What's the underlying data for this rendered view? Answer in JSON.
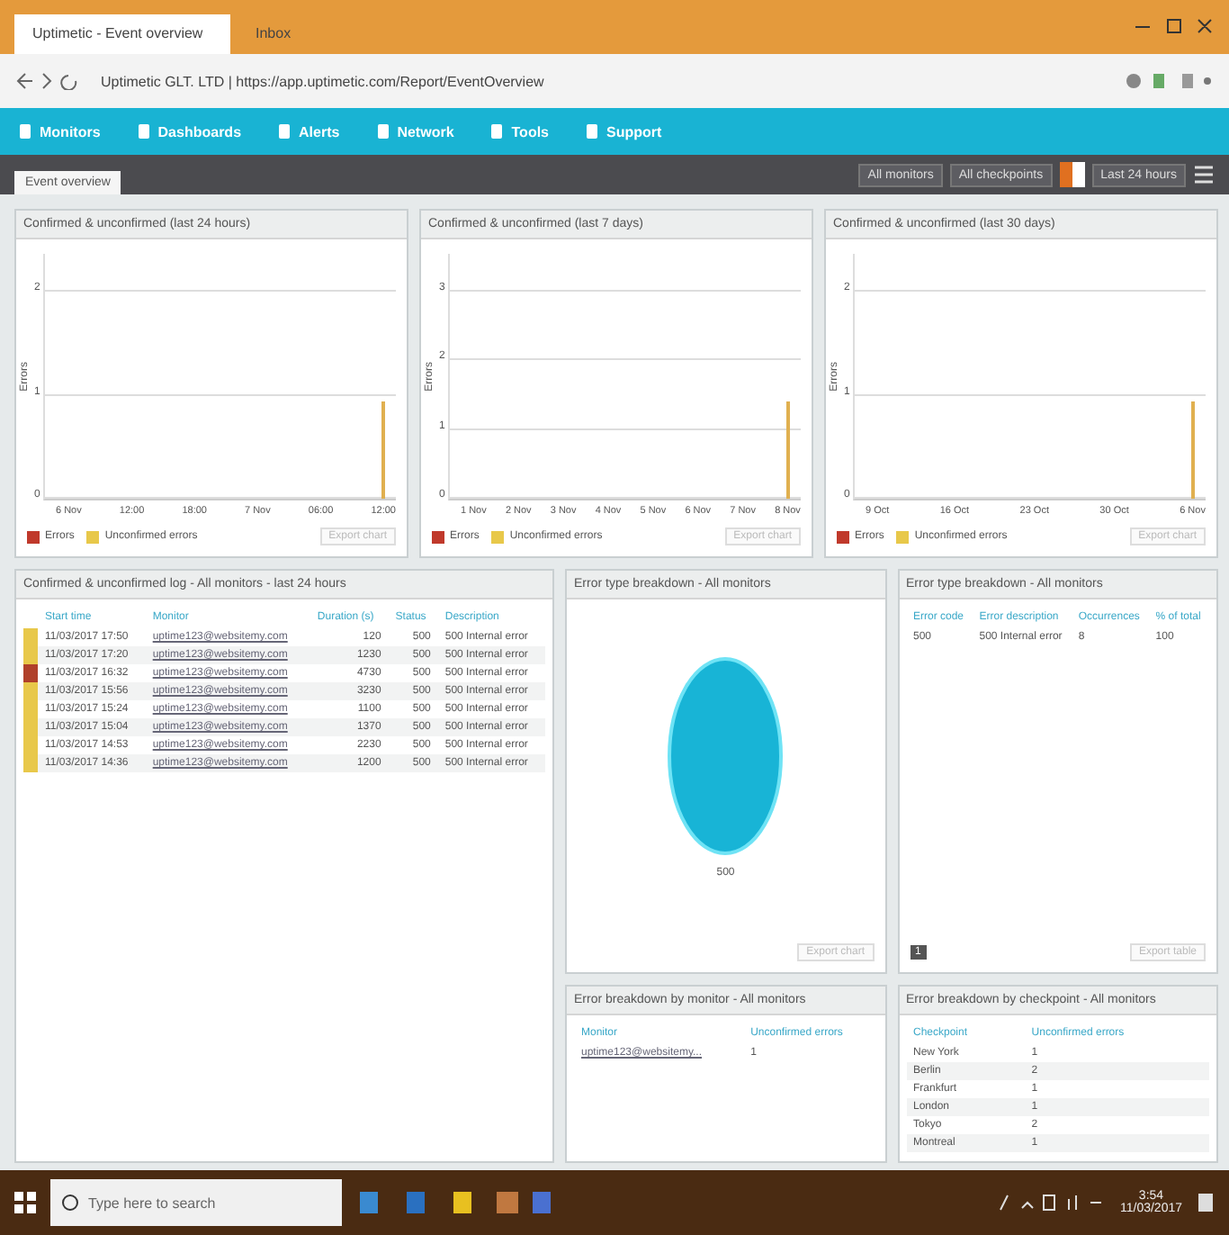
{
  "browser": {
    "tabs": [
      {
        "title": "Uptimetic - Event overview",
        "selected": true
      },
      {
        "title": "Inbox",
        "selected": false
      }
    ],
    "url": "Uptimetic GLT. LTD | https://app.uptimetic.com/Report/EventOverview"
  },
  "nav": [
    {
      "label": "Monitors"
    },
    {
      "label": "Dashboards"
    },
    {
      "label": "Alerts"
    },
    {
      "label": "Network"
    },
    {
      "label": "Tools"
    },
    {
      "label": "Support"
    }
  ],
  "toolbar": {
    "tab": "Event overview",
    "filters": [
      "All monitors",
      "All checkpoints"
    ],
    "period": "Last 24 hours"
  },
  "charts": [
    {
      "title": "Confirmed & unconfirmed (last 24 hours)",
      "ylabel": "Errors",
      "yticks": [
        "2",
        "1",
        "0"
      ],
      "xlabels": [
        "6 Nov",
        "12:00",
        "18:00",
        "7 Nov",
        "06:00",
        "12:00"
      ],
      "legend": [
        "Errors",
        "Unconfirmed errors"
      ],
      "export": "Export chart"
    },
    {
      "title": "Confirmed & unconfirmed (last 7 days)",
      "ylabel": "Errors",
      "yticks": [
        "3",
        "2",
        "1",
        "0"
      ],
      "xlabels": [
        "1 Nov",
        "2 Nov",
        "3 Nov",
        "4 Nov",
        "5 Nov",
        "6 Nov",
        "7 Nov",
        "8 Nov"
      ],
      "legend": [
        "Errors",
        "Unconfirmed errors"
      ],
      "export": "Export chart"
    },
    {
      "title": "Confirmed & unconfirmed (last 30 days)",
      "ylabel": "Errors",
      "yticks": [
        "2",
        "1",
        "0"
      ],
      "xlabels": [
        "9 Oct",
        "16 Oct",
        "23 Oct",
        "30 Oct",
        "6 Nov"
      ],
      "legend": [
        "Errors",
        "Unconfirmed errors"
      ],
      "export": "Export chart"
    }
  ],
  "events": {
    "title": "Confirmed & unconfirmed log - All monitors - last 24 hours",
    "columns": [
      "Start time",
      "Monitor",
      "Duration (s)",
      "Status",
      "Description"
    ],
    "rows": [
      {
        "color": "#e8c84a",
        "cells": [
          "11/03/2017 17:50",
          "uptime123@websitemy.com",
          "120",
          "500",
          "500 Internal error"
        ]
      },
      {
        "color": "#e8c84a",
        "cells": [
          "11/03/2017 17:20",
          "uptime123@websitemy.com",
          "1230",
          "500",
          "500 Internal error"
        ]
      },
      {
        "color": "#b0402a",
        "cells": [
          "11/03/2017 16:32",
          "uptime123@websitemy.com",
          "4730",
          "500",
          "500 Internal error"
        ]
      },
      {
        "color": "#e8c84a",
        "cells": [
          "11/03/2017 15:56",
          "uptime123@websitemy.com",
          "3230",
          "500",
          "500 Internal error"
        ]
      },
      {
        "color": "#e8c84a",
        "cells": [
          "11/03/2017 15:24",
          "uptime123@websitemy.com",
          "1100",
          "500",
          "500 Internal error"
        ]
      },
      {
        "color": "#e8c84a",
        "cells": [
          "11/03/2017 15:04",
          "uptime123@websitemy.com",
          "1370",
          "500",
          "500 Internal error"
        ]
      },
      {
        "color": "#e8c84a",
        "cells": [
          "11/03/2017 14:53",
          "uptime123@websitemy.com",
          "2230",
          "500",
          "500 Internal error"
        ]
      },
      {
        "color": "#e8c84a",
        "cells": [
          "11/03/2017 14:36",
          "uptime123@websitemy.com",
          "1200",
          "500",
          "500 Internal error"
        ]
      }
    ]
  },
  "pie": {
    "title": "Error type breakdown - All monitors",
    "label": "500",
    "export": "Export chart"
  },
  "types": {
    "title": "Error type breakdown - All monitors",
    "columns": [
      "Error code",
      "Error description",
      "Occurrences",
      "% of total"
    ],
    "rows": [
      [
        "500",
        "500 Internal error",
        "8",
        "100"
      ]
    ],
    "page": "1",
    "export": "Export table"
  },
  "by_monitor": {
    "title": "Error breakdown by monitor - All monitors",
    "columns": [
      "Monitor",
      "Unconfirmed errors"
    ],
    "rows": [
      [
        "uptime123@websitemy...",
        "1"
      ]
    ]
  },
  "by_checkpoint": {
    "title": "Error breakdown by checkpoint - All monitors",
    "columns": [
      "Checkpoint",
      "Unconfirmed errors"
    ],
    "rows": [
      [
        "New York",
        "1"
      ],
      [
        "Berlin",
        "2"
      ],
      [
        "Frankfurt",
        "1"
      ],
      [
        "London",
        "1"
      ],
      [
        "Tokyo",
        "2"
      ],
      [
        "Montreal",
        "1"
      ]
    ]
  },
  "taskbar": {
    "search": "Type here to search",
    "time": "3:54",
    "date": "11/03/2017"
  }
}
